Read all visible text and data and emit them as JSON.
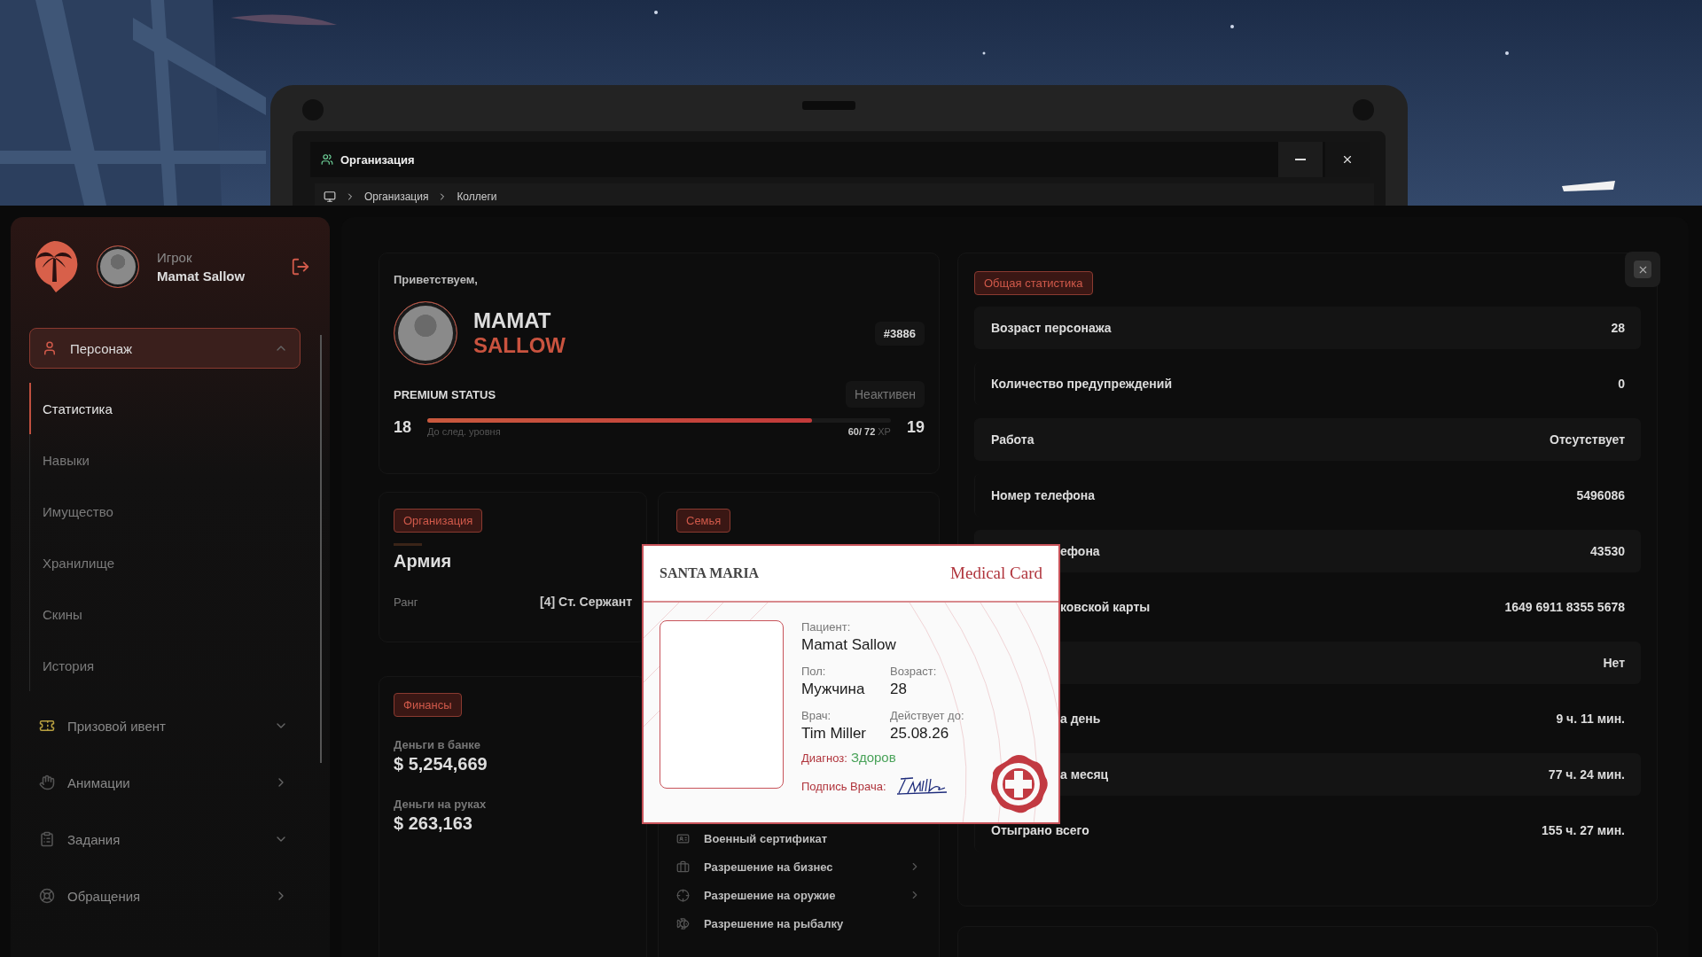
{
  "window": {
    "title": "Организация",
    "breadcrumb": [
      "Организация",
      "Коллеги"
    ]
  },
  "sidebar": {
    "role": "Игрок",
    "player": "Mamat Sallow",
    "menu": [
      {
        "label": "Персонаж",
        "kind": "dropdown",
        "expanded": true,
        "children": [
          {
            "label": "Статистика",
            "selected": true
          },
          {
            "label": "Навыки",
            "selected": false
          },
          {
            "label": "Имущество",
            "selected": false
          },
          {
            "label": "Хранилище",
            "selected": false
          },
          {
            "label": "Скины",
            "selected": false
          },
          {
            "label": "История",
            "selected": false
          }
        ]
      },
      {
        "label": "Призовой ивент",
        "kind": "dropdown",
        "expanded": false
      },
      {
        "label": "Анимации",
        "kind": "link"
      },
      {
        "label": "Задания",
        "kind": "dropdown",
        "expanded": false
      },
      {
        "label": "Обращения",
        "kind": "link"
      }
    ]
  },
  "welcome": {
    "greeting": "Приветствуем,",
    "first_name": "MAMAT",
    "last_name": "SALLOW",
    "id": "#3886",
    "premium_label": "PREMIUM STATUS",
    "premium_status": "Неактивен",
    "level_current": "18",
    "level_next": "19",
    "level_caption": "До след. уровня",
    "xp": "60/ 72",
    "xp_unit": "XP",
    "level": 0.83
  },
  "organization": {
    "badge": "Организация",
    "name": "Армия",
    "rank_label": "Ранг",
    "rank": "[4] Ст. Сержант"
  },
  "family": {
    "badge": "Семья",
    "licenses": [
      {
        "label": "Военный сертификат",
        "expandable": false
      },
      {
        "label": "Разрешение на бизнес",
        "expandable": true
      },
      {
        "label": "Разрешение на оружие",
        "expandable": true
      },
      {
        "label": "Разрешение на рыбалку",
        "expandable": false
      }
    ]
  },
  "finance": {
    "badge": "Финансы",
    "items": [
      {
        "label": "Деньги в банке",
        "value": "$ 5,254,669"
      },
      {
        "label": "Деньги на руках",
        "value": "$ 263,163"
      }
    ]
  },
  "stats": {
    "badge": "Общая статистика",
    "rows": [
      {
        "kind": "full",
        "label": "Возраст персонажа",
        "value": "28"
      },
      {
        "kind": "full",
        "label": "Количество предупреждений",
        "value": "0"
      },
      {
        "kind": "full",
        "label": "Работа",
        "value": "Отсутствует"
      },
      {
        "kind": "full",
        "label": "Номер телефона",
        "value": "5496086"
      },
      {
        "kind": "partial",
        "label": "ефона",
        "value": "43530"
      },
      {
        "kind": "partial",
        "label": "ковской карты",
        "value": "1649 6911 8355 5678"
      },
      {
        "value": "Нет"
      },
      {
        "kind": "partial",
        "label": "а день",
        "value": "9 ч. 11 мин."
      },
      {
        "kind": "partial",
        "label": "а месяц",
        "value": "77 ч. 24 мин."
      },
      {
        "kind": "full",
        "label": "Отыграно всего",
        "value": "155 ч. 27 мин."
      }
    ]
  },
  "medical_card": {
    "org": "SANTA MARIA",
    "title": "Medical Card",
    "patient_label": "Пациент:",
    "patient": "Mamat Sallow",
    "gender_label": "Пол:",
    "gender": "Мужчина",
    "age_label": "Возраст:",
    "age": "28",
    "doctor_label": "Врач:",
    "doctor": "Tim Miller",
    "valid_label": "Действует до:",
    "valid": "25.08.26",
    "diagnosis_label": "Диагноз:",
    "diagnosis": "Здоров",
    "signature_label": "Подпись Врача:"
  }
}
